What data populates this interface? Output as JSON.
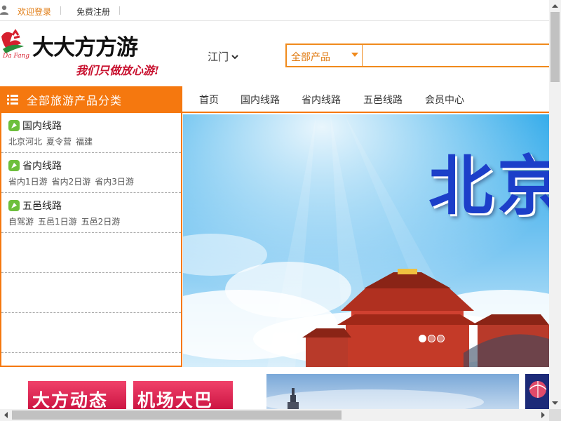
{
  "topbar": {
    "user_icon": "user-icon",
    "login_label": "欢迎登录",
    "register_label": "免费注册"
  },
  "header": {
    "logo_text": "大大方方游",
    "logo_slogan": "我们只做放心游!",
    "city": "江门",
    "search": {
      "category": "全部产品",
      "placeholder": "",
      "value": ""
    }
  },
  "category_menu": {
    "title": "全部旅游产品分类",
    "items": [
      {
        "title": "国内线路",
        "subs": [
          "北京河北",
          "夏令营",
          "福建"
        ]
      },
      {
        "title": "省内线路",
        "subs": [
          "省内1日游",
          "省内2日游",
          "省内3日游"
        ]
      },
      {
        "title": "五邑线路",
        "subs": [
          "自驾游",
          "五邑1日游",
          "五邑2日游"
        ]
      }
    ]
  },
  "nav": {
    "items": [
      "首页",
      "国内线路",
      "省内线路",
      "五邑线路",
      "会员中心"
    ]
  },
  "banner": {
    "title": "北京",
    "slide_count": 3,
    "active_slide": 1
  },
  "promos": {
    "dynamic": "大方动态",
    "airport_bus": "机场大巴"
  },
  "colors": {
    "accent": "#f5780f",
    "link_orange": "#e07a10",
    "banner_text": "#1c3fc9",
    "promo_red": "#d81e4a"
  }
}
